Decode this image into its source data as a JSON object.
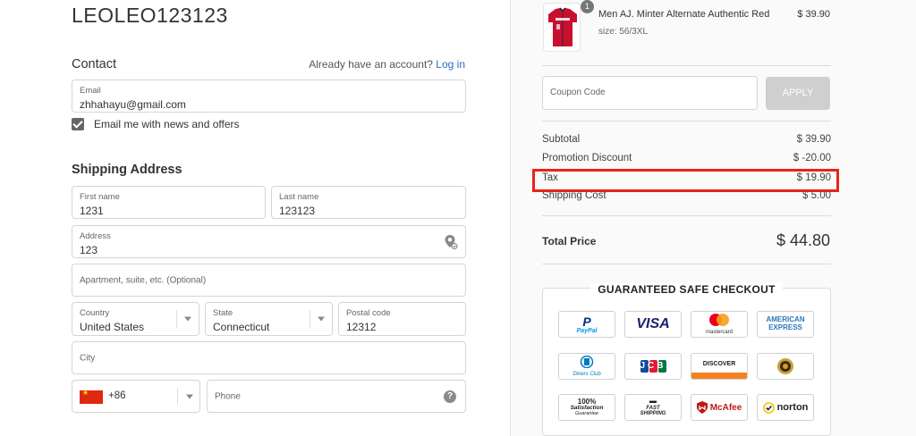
{
  "store": {
    "title": "LEOLEO123123"
  },
  "contact": {
    "title": "Contact",
    "login_prompt": "Already have an account?",
    "login_link": "Log in",
    "email_label": "Email",
    "email_value": "zhhahayu@gmail.com",
    "newsletter_label": "Email me with news and offers",
    "newsletter_checked": true
  },
  "shipping": {
    "title": "Shipping Address",
    "first_name_label": "First name",
    "first_name_value": "1231",
    "last_name_label": "Last name",
    "last_name_value": "123123",
    "address_label": "Address",
    "address_value": "123",
    "apartment_placeholder": "Apartment, suite, etc. (Optional)",
    "country_label": "Country",
    "country_value": "United States",
    "state_label": "State",
    "state_value": "Connecticut",
    "postal_label": "Postal code",
    "postal_value": "12312",
    "city_placeholder": "City",
    "phone_code": "+86",
    "phone_placeholder": "Phone",
    "help_icon": "?"
  },
  "order": {
    "product": {
      "name": "Men AJ. Minter Alternate Authentic Red",
      "variant": "size: 56/3XL",
      "price": "$ 39.90",
      "quantity": "1"
    },
    "coupon_placeholder": "Coupon Code",
    "apply_label": "APPLY",
    "summary": [
      {
        "label": "Subtotal",
        "value": "$ 39.90"
      },
      {
        "label": "Promotion Discount",
        "value": "$ -20.00"
      },
      {
        "label": "Tax",
        "value": "$ 19.90"
      },
      {
        "label": "Shipping Cost",
        "value": "$ 5.00"
      }
    ],
    "total_label": "Total Price",
    "total_value": "$ 44.80",
    "highlight_color": "#e8231a"
  },
  "guarantee": {
    "title": "GUARANTEED SAFE CHECKOUT",
    "badges": {
      "paypal": "PayPal",
      "visa": "VISA",
      "mastercard": "mastercard",
      "amex_top": "AMERICAN",
      "amex_bottom": "EXPRESS",
      "diners": "Diners Club",
      "jcb": "JCB",
      "discover": "DISCOVER",
      "pct_top": "100%",
      "pct_mid": "Satisfaction",
      "pct_bottom": "Guarantee",
      "fast_top": "FAST",
      "fast_bottom": "SHIPPING",
      "mcafee": "McAfee",
      "norton": "norton"
    }
  }
}
